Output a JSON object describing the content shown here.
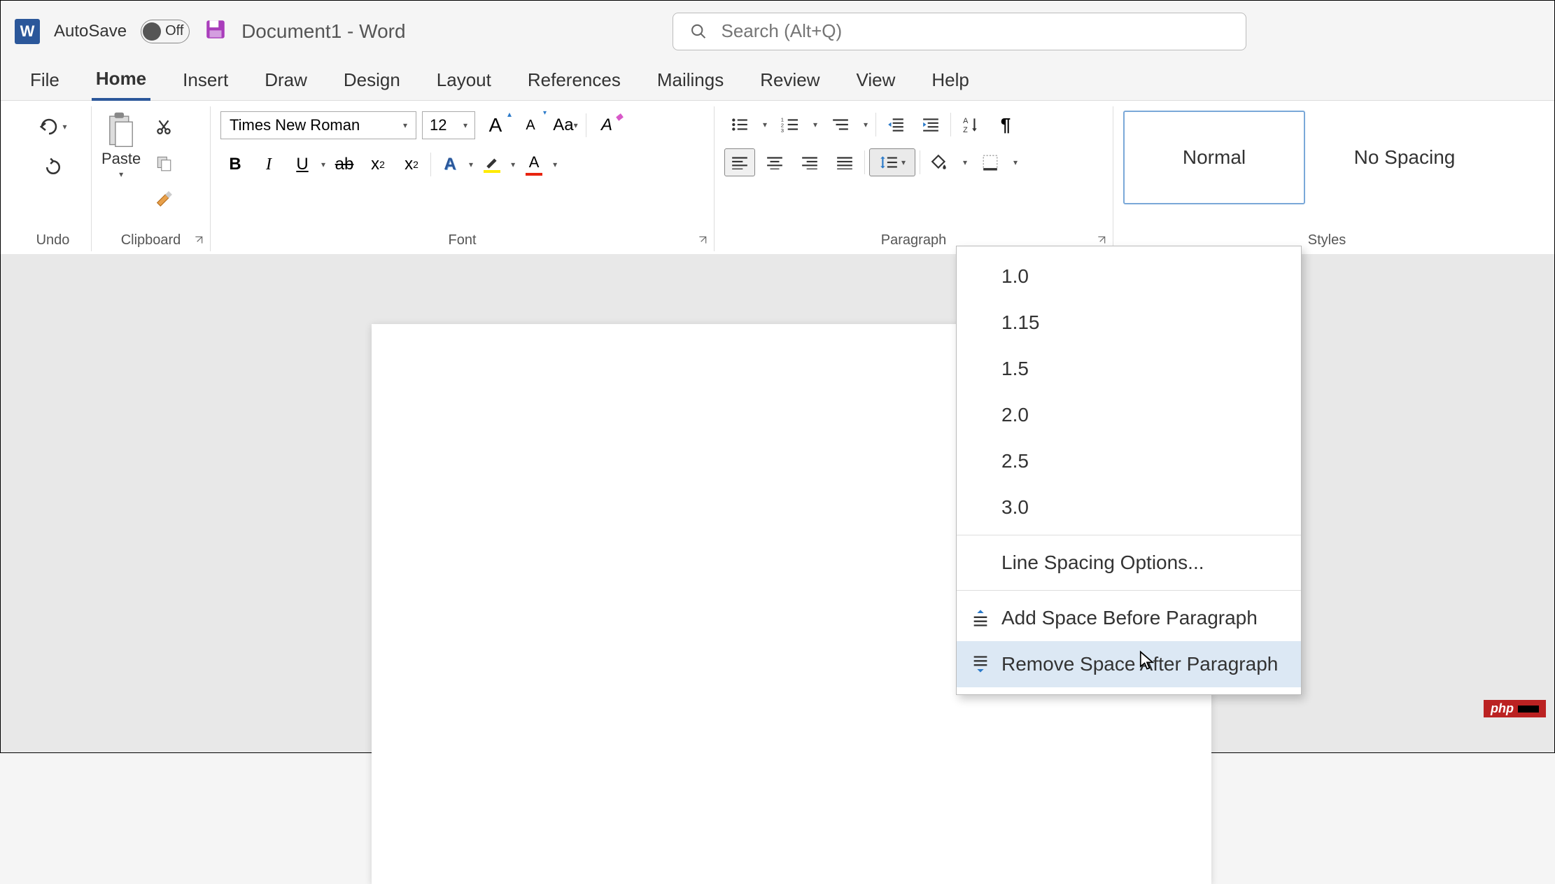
{
  "titlebar": {
    "autosave_label": "AutoSave",
    "autosave_state": "Off",
    "doc_title": "Document1  -  Word"
  },
  "search": {
    "placeholder": "Search (Alt+Q)"
  },
  "tabs": {
    "file": "File",
    "home": "Home",
    "insert": "Insert",
    "draw": "Draw",
    "design": "Design",
    "layout": "Layout",
    "references": "References",
    "mailings": "Mailings",
    "review": "Review",
    "view": "View",
    "help": "Help"
  },
  "ribbon": {
    "undo": {
      "label": "Undo"
    },
    "clipboard": {
      "label": "Clipboard",
      "paste": "Paste"
    },
    "font": {
      "label": "Font",
      "name": "Times New Roman",
      "size": "12",
      "case": "Aa"
    },
    "paragraph": {
      "label": "Paragraph"
    },
    "styles": {
      "label": "Styles",
      "normal": "Normal",
      "no_spacing": "No Spacing"
    }
  },
  "spacing_menu": {
    "v1": "1.0",
    "v2": "1.15",
    "v3": "1.5",
    "v4": "2.0",
    "v5": "2.5",
    "v6": "3.0",
    "options": "Line Spacing Options...",
    "add_before": "Add Space Before Paragraph",
    "remove_after": "Remove Space After Paragraph"
  },
  "badge": "php"
}
